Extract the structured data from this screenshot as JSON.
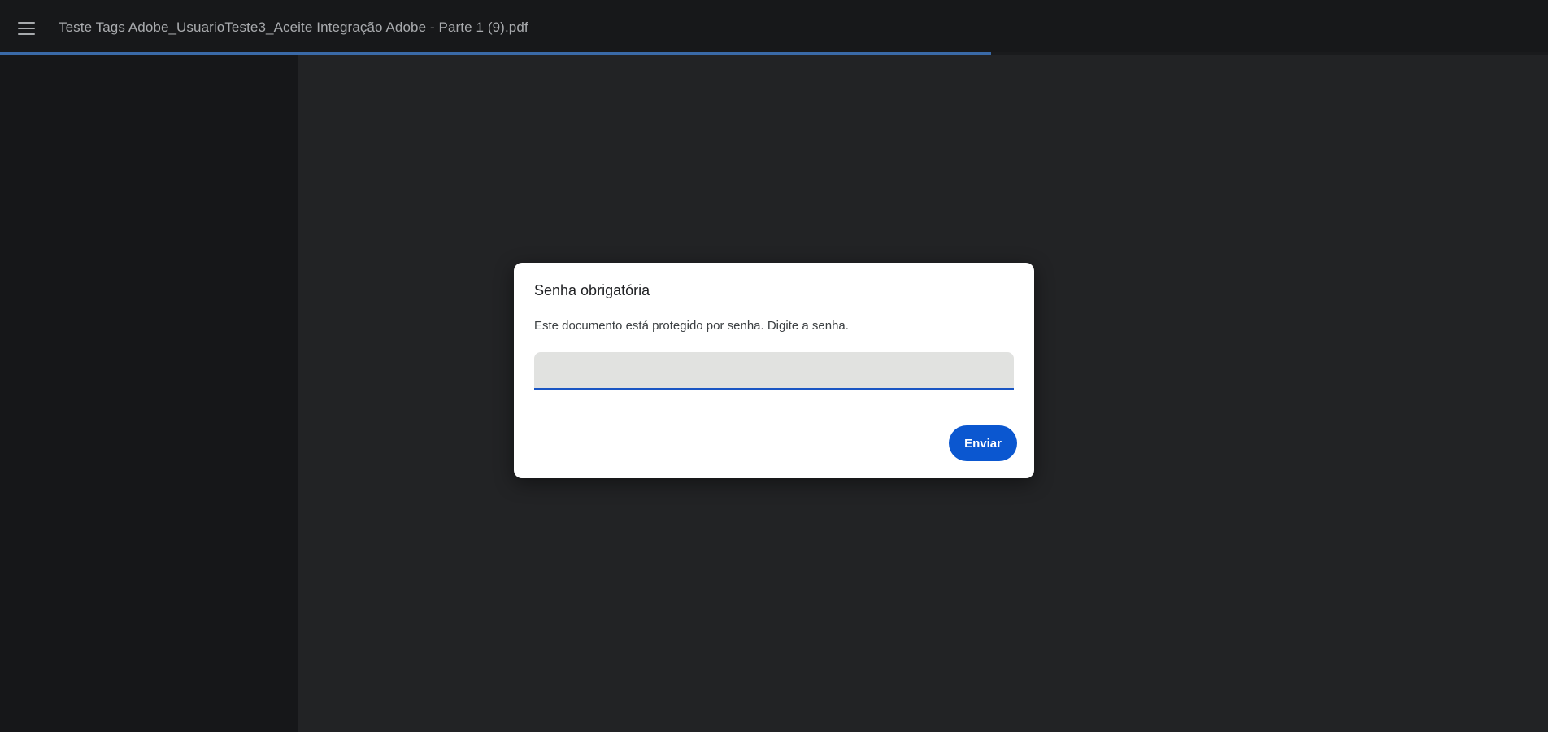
{
  "toolbar": {
    "menu_icon": "hamburger-menu-icon",
    "document_title": "Teste Tags Adobe_UsuarioTeste3_Aceite Integração Adobe - Parte 1 (9).pdf",
    "load_progress_percent": 64
  },
  "dialog": {
    "title": "Senha obrigatória",
    "message": "Este documento está protegido por senha. Digite a senha.",
    "password_value": "",
    "password_placeholder": "",
    "submit_label": "Enviar"
  },
  "colors": {
    "accent": "#0b57d0",
    "toolbar_bg": "#17181a",
    "viewer_bg": "#222325",
    "sidebar_bg": "#161719",
    "progress": "#3a6aa8"
  }
}
